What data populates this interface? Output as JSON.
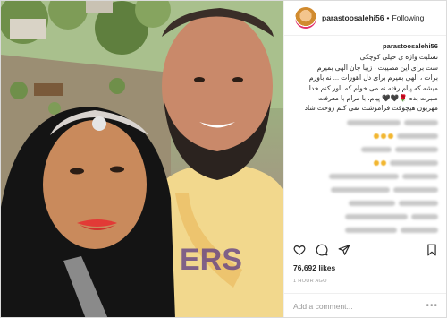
{
  "post": {
    "username": "parastoosalehi56",
    "separator": "•",
    "follow_status": "Following",
    "caption_lines": [
      "تسلیت واژه ی خیلی کوچکی",
      "ست برای این مصیبت ، زیبا جان الهی بمیرم",
      "برات ، الهی بمیرم برای دل اهورات ... نه باورم",
      "میشه که پیام رفته نه می خوام که باور کنم خدا",
      "صبرت بده 🌹🖤🖤 پیام، با مرام با معرفت",
      "مهربون هیچوقت فراموشت نمی کنم روحت شاد"
    ],
    "likes": "76,692 likes",
    "timestamp": "1 HOUR AGO",
    "add_comment_placeholder": "Add a comment...",
    "more_icon_text": "•••"
  },
  "icons": {
    "avatar": "profile-avatar",
    "heart": "heart-icon",
    "comment": "comment-bubble-icon",
    "share": "share-plane-icon",
    "save": "bookmark-icon"
  }
}
